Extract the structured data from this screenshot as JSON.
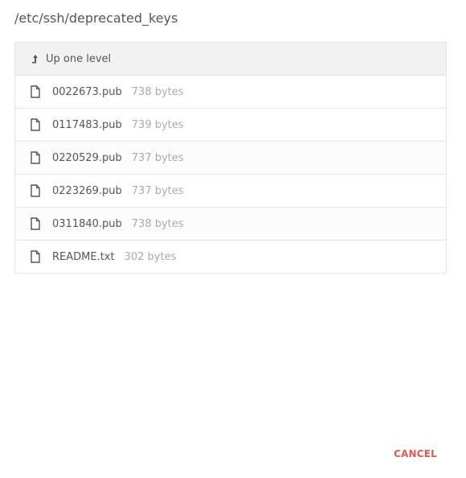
{
  "dialog": {
    "path": "/etc/ssh/deprecated_keys",
    "up_label": "Up one level",
    "cancel_label": "CANCEL",
    "accent_color": "#e05a4f"
  },
  "files": [
    {
      "name": "0022673.pub",
      "size": "738 bytes",
      "icon": "file-icon"
    },
    {
      "name": "0117483.pub",
      "size": "739 bytes",
      "icon": "file-icon"
    },
    {
      "name": "0220529.pub",
      "size": "737 bytes",
      "icon": "file-icon"
    },
    {
      "name": "0223269.pub",
      "size": "737 bytes",
      "icon": "file-icon"
    },
    {
      "name": "0311840.pub",
      "size": "738 bytes",
      "icon": "file-icon"
    },
    {
      "name": "README.txt",
      "size": "302 bytes",
      "icon": "file-icon"
    }
  ]
}
